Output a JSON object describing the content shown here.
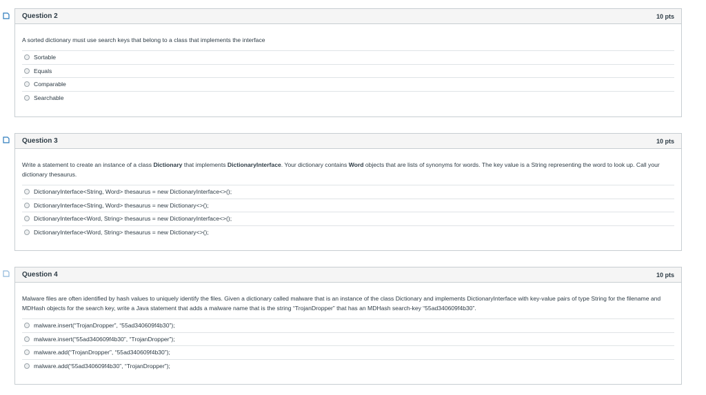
{
  "questions": [
    {
      "title": "Question 2",
      "points": "10 pts",
      "text_parts": [
        {
          "t": "A sorted dictionary must use search keys that belong to a class that implements the interface",
          "b": false
        }
      ],
      "answers": [
        "Sortable",
        "Equals",
        "Comparable",
        "Searchable"
      ]
    },
    {
      "title": "Question 3",
      "points": "10 pts",
      "text_parts": [
        {
          "t": "Write a statement to create an instance of a class ",
          "b": false
        },
        {
          "t": "Dictionary",
          "b": true
        },
        {
          "t": " that implements ",
          "b": false
        },
        {
          "t": "DictionaryInterface",
          "b": true
        },
        {
          "t": ". Your dictionary contains ",
          "b": false
        },
        {
          "t": "Word",
          "b": true
        },
        {
          "t": " objects that are lists of synonyms for words. The key value is a String representing the word to look up. Call your dictionary thesaurus.",
          "b": false
        }
      ],
      "answers": [
        "DictionaryInterface<String, Word> thesaurus = new DictionaryInterface<>();",
        "DictionaryInterface<String, Word> thesaurus = new Dictionary<>();",
        "DictionaryInterface<Word, String> thesaurus = new DictionaryInterface<>();",
        "DictionaryInterface<Word, String> thesaurus = new Dictionary<>();"
      ]
    },
    {
      "title": "Question 4",
      "points": "10 pts",
      "text_parts": [
        {
          "t": "Malware files are often identified by hash values to uniquely identify the files. Given a dictionary called malware that is an instance of the class Dictionary and implements DictionaryInterface with key-value pairs of type String for the filename and MDHash objects for the search key, write a Java statement that adds a malware name that is the string “TrojanDropper” that has an MDHash search-key “55ad340609f4b30”.",
          "b": false
        }
      ],
      "answers": [
        "malware.insert(“TrojanDropper”, “55ad340609f4b30”);",
        "malware.insert(“55ad340609f4b30”, “TrojanDropper”);",
        "malware.add(“TrojanDropper”, “55ad340609f4b30”);",
        "malware.add(“55ad340609f4b30”, “TrojanDropper”);"
      ]
    }
  ]
}
